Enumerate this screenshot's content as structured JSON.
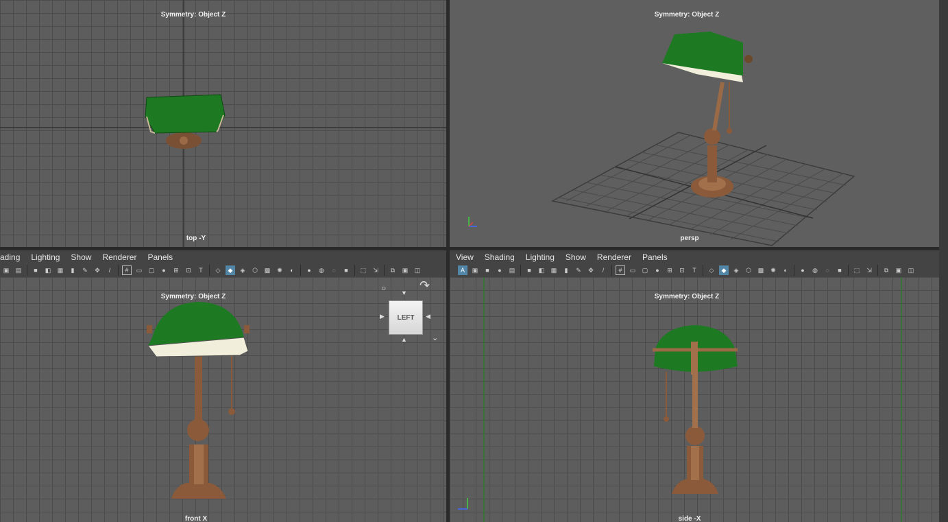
{
  "viewports": {
    "top": {
      "symmetry": "Symmetry: Object Z",
      "camera": "top -Y"
    },
    "persp": {
      "symmetry": "Symmetry: Object Z",
      "camera": "persp"
    },
    "front": {
      "symmetry": "Symmetry: Object Z",
      "camera": "front X"
    },
    "side": {
      "symmetry": "Symmetry: Object Z",
      "camera": "side -X"
    }
  },
  "menus": {
    "left": [
      "ading",
      "Lighting",
      "Show",
      "Renderer",
      "Panels"
    ],
    "right": [
      "View",
      "Shading",
      "Lighting",
      "Show",
      "Renderer",
      "Panels"
    ]
  },
  "viewcube": {
    "face": "LEFT"
  },
  "axes": {
    "x": "x",
    "y": "y",
    "z": "z"
  },
  "colors": {
    "shade_green": "#1e7a22",
    "brass": "#8a5a3a",
    "shade_inner": "#f2eedc",
    "grid_bg": "#5d5d5d",
    "accent": "#5285a6"
  }
}
